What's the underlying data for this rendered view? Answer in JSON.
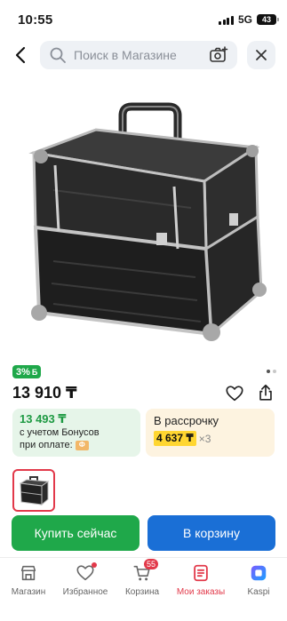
{
  "status_bar": {
    "time": "10:55",
    "network": "5G",
    "battery": "43"
  },
  "search": {
    "placeholder": "Поиск в Магазине"
  },
  "product": {
    "bonus_badge": "3%",
    "bonus_badge_suffix": "Б",
    "price": "13 910 ₸",
    "bonus_price": "13 493 ₸",
    "bonus_text_line1": "с учетом Бонусов",
    "bonus_text_line2": "при оплате:",
    "bonus_coin": "Ф",
    "installment_title": "В рассрочку",
    "installment_amount": "4 637 ₸",
    "installment_multiplier": "×3"
  },
  "actions": {
    "buy_now": "Купить сейчас",
    "add_to_cart": "В корзину"
  },
  "tabs": [
    {
      "label": "Магазин",
      "icon": "shop-icon"
    },
    {
      "label": "Избранное",
      "icon": "heart-icon"
    },
    {
      "label": "Корзина",
      "icon": "cart-icon",
      "badge": "55"
    },
    {
      "label": "Мои заказы",
      "icon": "orders-icon",
      "active": true
    },
    {
      "label": "Kaspi",
      "icon": "kaspi-app-icon"
    }
  ],
  "colors": {
    "green": "#1fa84a",
    "blue": "#1a6fd6",
    "red": "#e2394a",
    "yellow": "#ffd631"
  }
}
